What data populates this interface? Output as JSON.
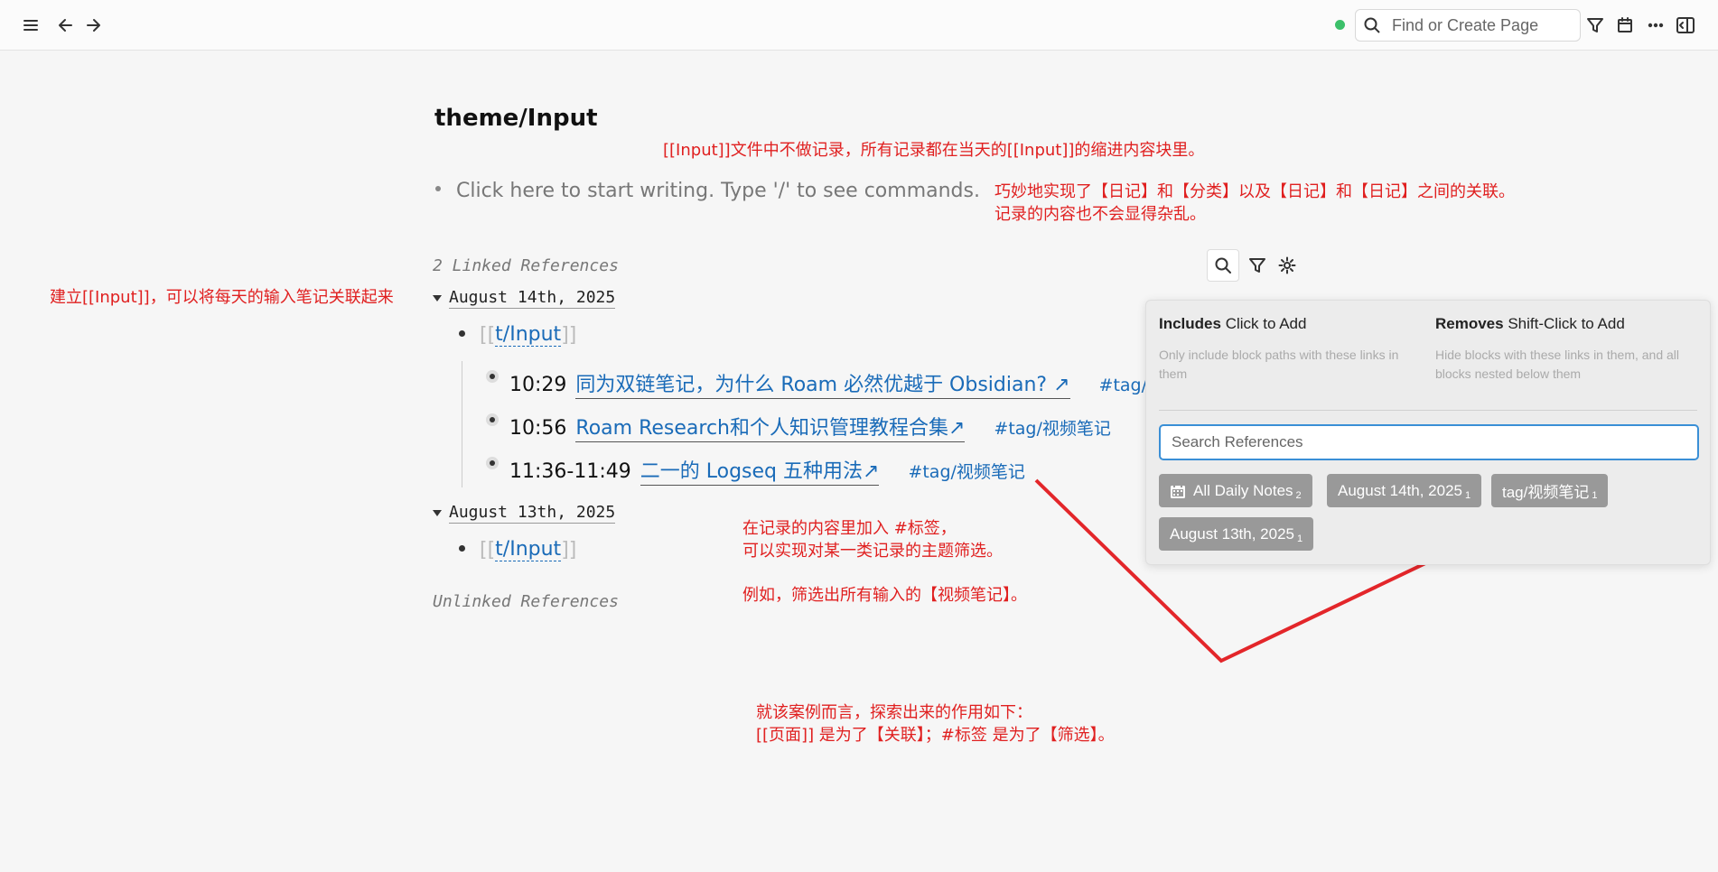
{
  "topbar": {
    "search_placeholder": "Find or Create Page",
    "icons": [
      "menu-icon",
      "back-arrow-icon",
      "forward-arrow-icon",
      "search-icon",
      "filter-icon",
      "calendar-icon",
      "more-icon",
      "sidebar-toggle-icon"
    ]
  },
  "page": {
    "title": "theme/Input",
    "placeholder": "Click here to start writing. Type '/' to see commands."
  },
  "annotations": {
    "top_note": "[[Input]]文件中不做记录，所有记录都在当天的[[Input]]的缩进内容块里。",
    "right_note_line1": "巧妙地实现了【日记】和【分类】以及【日记】和【日记】之间的关联。",
    "right_note_line2": "记录的内容也不会显得杂乱。",
    "left_note": "建立[[Input]]，可以将每天的输入笔记关联起来",
    "mid_note_line1": "在记录的内容里加入 #标签，",
    "mid_note_line2": "可以实现对某一类记录的主题筛选。",
    "mid_note_line3": "例如，筛选出所有输入的【视频笔记】。",
    "bottom_note_line1": "就该案例而言，探索出来的作用如下：",
    "bottom_note_line2": "[[页面]] 是为了【关联】；#标签 是为了【筛选】。"
  },
  "references": {
    "linked_heading": "2 Linked References",
    "unlinked_heading": "Unlinked References",
    "groups": [
      {
        "date": "August 14th, 2025",
        "page_ref": "t/Input",
        "open_bracket": "[[",
        "close_bracket": "]]",
        "entries": [
          {
            "time": "10:29",
            "link": "同为双链笔记，为什么 Roam 必然优越于 Obsidian? ↗",
            "tag": "#tag/视频笔记"
          },
          {
            "time": "10:56",
            "link": "Roam Research和个人知识管理教程合集↗",
            "tag": "#tag/视频笔记"
          },
          {
            "time": "11:36-11:49",
            "link": "二一的 Logseq 五种用法↗",
            "tag": "#tag/视频笔记"
          }
        ]
      },
      {
        "date": "August 13th, 2025",
        "page_ref": "t/Input",
        "open_bracket": "[[",
        "close_bracket": "]]"
      }
    ]
  },
  "filter_panel": {
    "includes_title": "Includes",
    "includes_hint": "Click to Add",
    "includes_desc": "Only include block paths with these links in them",
    "removes_title": "Removes",
    "removes_hint": "Shift-Click to Add",
    "removes_desc": "Hide blocks with these links in them, and all blocks nested below them",
    "search_placeholder": "Search References",
    "chips": [
      {
        "label": "All Daily Notes",
        "count": "2"
      },
      {
        "label": "August 14th, 2025",
        "count": "1"
      },
      {
        "label": "tag/视频笔记",
        "count": "1"
      },
      {
        "label": "August 13th, 2025",
        "count": "1"
      }
    ]
  },
  "colors": {
    "accent_link": "#1a6bb8",
    "annotation_red": "#e02020",
    "sync_green": "#3cc06a",
    "chip_gray": "#999999"
  }
}
